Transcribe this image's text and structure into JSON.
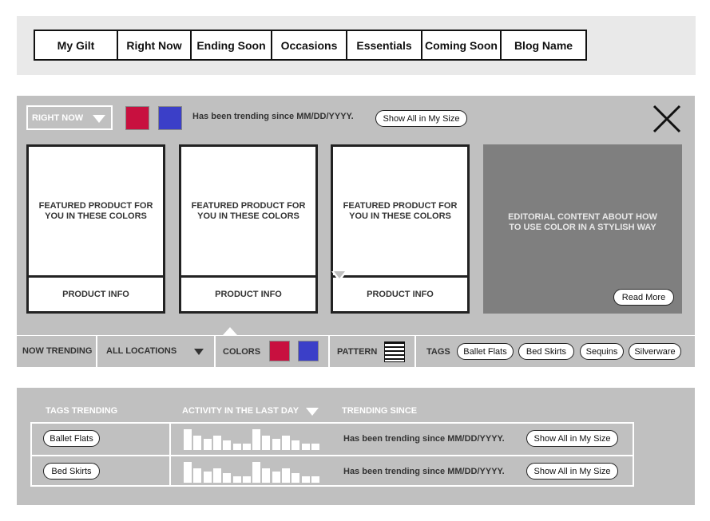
{
  "nav": {
    "items": [
      {
        "label": "My Gilt",
        "w": 104
      },
      {
        "label": "Right Now",
        "w": 92
      },
      {
        "label": "Ending Soon",
        "w": 101
      },
      {
        "label": "Occasions",
        "w": 94
      },
      {
        "label": "Essentials",
        "w": 94
      },
      {
        "label": "Coming Soon",
        "w": 99
      },
      {
        "label": "Blog Name",
        "w": 105
      }
    ]
  },
  "panel": {
    "dropdown_label": "RIGHT NOW",
    "colors": [
      "#c8103f",
      "#3b3fc8"
    ],
    "trending_text": "Has been trending since MM/DD/YYYY.",
    "show_all_label": "Show All in My Size",
    "cards": [
      {
        "featured": "FEATURED PRODUCT FOR YOU IN THESE COLORS",
        "info": "PRODUCT INFO"
      },
      {
        "featured": "FEATURED PRODUCT FOR YOU IN THESE COLORS",
        "info": "PRODUCT INFO"
      },
      {
        "featured": "FEATURED PRODUCT FOR YOU IN THESE COLORS",
        "info": "PRODUCT INFO"
      }
    ],
    "editorial": {
      "text": "EDITORIAL CONTENT ABOUT HOW TO USE COLOR IN A STYLISH WAY",
      "read_more": "Read More"
    }
  },
  "filters": {
    "now_trending": "NOW TRENDING",
    "locations": "ALL LOCATIONS",
    "colors_label": "COLORS",
    "pattern_label": "PATTERN",
    "tags_label": "TAGS",
    "tags": [
      "Ballet Flats",
      "Bed Skirts",
      "Sequins",
      "Silverware"
    ]
  },
  "bottom": {
    "headers": {
      "tags": "TAGS TRENDING",
      "activity": "ACTIVITY IN THE LAST DAY",
      "since": "TRENDING SINCE"
    },
    "rows": [
      {
        "tag": "Ballet Flats",
        "since": "Has been trending since MM/DD/YYYY.",
        "show_all": "Show All in My Size",
        "activity": [
          26,
          18,
          14,
          18,
          12,
          8,
          8,
          26,
          18,
          14,
          18,
          12,
          8,
          8
        ]
      },
      {
        "tag": "Bed Skirts",
        "since": "Has been trending since MM/DD/YYYY.",
        "show_all": "Show All in My Size",
        "activity": [
          26,
          18,
          14,
          18,
          12,
          8,
          8,
          26,
          18,
          14,
          18,
          12,
          8,
          8
        ]
      }
    ]
  }
}
